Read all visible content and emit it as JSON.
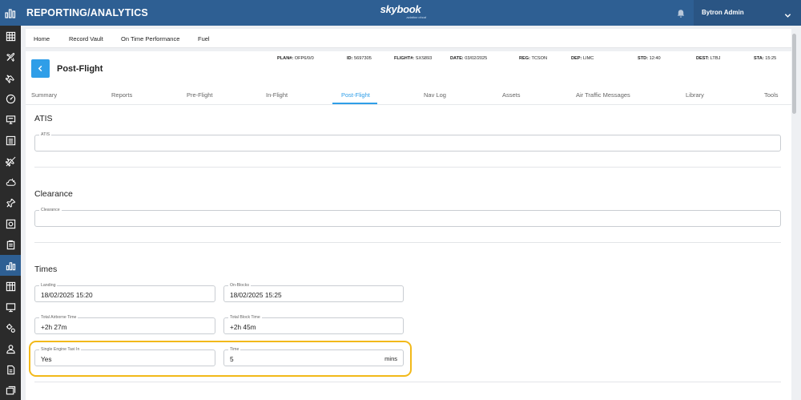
{
  "header": {
    "app_title": "REPORTING/ANALYTICS",
    "brand": "skybook",
    "brand_tagline": "aviation cloud",
    "user_name": "Bytron Admin"
  },
  "sidebar": {
    "icons": [
      "grid-icon",
      "plane-icon",
      "plane-alt-icon",
      "gauge-icon",
      "monitor-icon",
      "list-icon",
      "crossed-plane-icon",
      "weather-icon",
      "pin-icon",
      "chart-box-icon",
      "clipboard-icon",
      "analytics-icon",
      "table-icon",
      "screen-icon",
      "settings-icon",
      "user-icon",
      "document-icon",
      "images-icon"
    ],
    "active_index": 11
  },
  "subnav": {
    "items": [
      "Home",
      "Record Vault",
      "On Time Performance",
      "Fuel"
    ]
  },
  "page": {
    "title": "Post-Flight"
  },
  "flight_info": [
    {
      "label": "PLAN#:",
      "value": "OFP6/0/0"
    },
    {
      "label": "ID:",
      "value": "5697305"
    },
    {
      "label": "FLIGHT#:",
      "value": "SXS893"
    },
    {
      "label": "DATE:",
      "value": "03/02/2025"
    },
    {
      "label": "REG:",
      "value": "TCSON"
    },
    {
      "label": "DEP:",
      "value": "LIMC"
    },
    {
      "label": "STD:",
      "value": "12:40"
    },
    {
      "label": "DEST:",
      "value": "LTBJ"
    },
    {
      "label": "STA:",
      "value": "15:25"
    }
  ],
  "tabs": {
    "items": [
      "Summary",
      "Reports",
      "Pre-Flight",
      "In-Flight",
      "Post-Flight",
      "Nav Log",
      "Assets",
      "Air Traffic Messages",
      "Library",
      "Tools"
    ],
    "active": "Post-Flight"
  },
  "sections": {
    "atis": {
      "title": "ATIS",
      "field_label": "ATIS",
      "field_value": ""
    },
    "clearance": {
      "title": "Clearance",
      "field_label": "Clearance",
      "field_value": ""
    },
    "times": {
      "title": "Times",
      "landing": {
        "label": "Landing",
        "value": "18/02/2025 15:20"
      },
      "on_blocks": {
        "label": "On-Blocks",
        "value": "18/02/2025 15:25"
      },
      "total_airborne": {
        "label": "Total Airborne Time",
        "value": "+2h 27m"
      },
      "total_block": {
        "label": "Total Block Time",
        "value": "+2h 45m"
      },
      "single_engine_taxi_in": {
        "label": "Single Engine Taxi In",
        "value": "Yes"
      },
      "time": {
        "label": "Time",
        "value": "5",
        "unit": "mins"
      }
    }
  },
  "colors": {
    "header_bg": "#2e5f93",
    "sidebar_bg": "#2b2b2b",
    "accent": "#2f9ee8",
    "highlight": "#f2b91a"
  }
}
